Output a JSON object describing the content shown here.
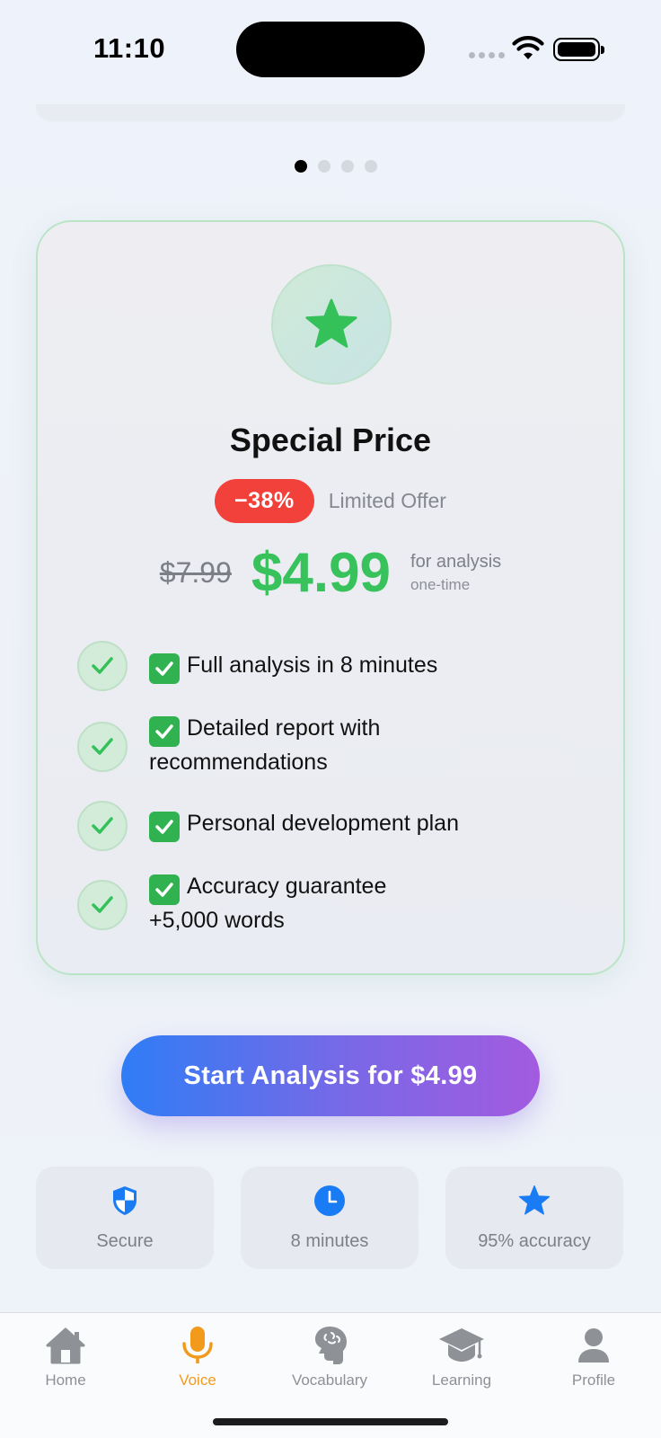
{
  "status_bar": {
    "time": "11:10"
  },
  "pager": {
    "total": 4,
    "active_index": 0
  },
  "offer_card": {
    "icon": "star-icon",
    "title": "Special Price",
    "discount": "−38%",
    "offer_label": "Limited Offer",
    "old_price": "$7.99",
    "new_price": "$4.99",
    "price_note": "for analysis",
    "price_subnote": "one-time",
    "features": [
      {
        "lines": [
          "Full analysis in 8 minutes"
        ]
      },
      {
        "lines": [
          "Detailed report with",
          "recommendations"
        ]
      },
      {
        "lines": [
          "Personal development plan"
        ]
      },
      {
        "lines": [
          "Accuracy guarantee",
          "+5,000 words"
        ]
      }
    ]
  },
  "cta": {
    "label": "Start Analysis for $4.99"
  },
  "trust_badges": [
    {
      "icon": "shield-icon",
      "label": "Secure"
    },
    {
      "icon": "clock-icon",
      "label": "8 minutes"
    },
    {
      "icon": "star-icon",
      "label": "95% accuracy"
    }
  ],
  "tab_bar": {
    "active": "Voice",
    "tabs": [
      {
        "icon": "house-icon",
        "label": "Home"
      },
      {
        "icon": "microphone-icon",
        "label": "Voice"
      },
      {
        "icon": "brain-icon",
        "label": "Vocabulary"
      },
      {
        "icon": "graduation-cap-icon",
        "label": "Learning"
      },
      {
        "icon": "person-icon",
        "label": "Profile"
      }
    ]
  },
  "colors": {
    "accent_green": "#38c25c",
    "discount_red": "#f2413a",
    "cta_gradient_start": "#2f7df6",
    "cta_gradient_end": "#a35be0",
    "active_tab": "#f29a1c",
    "trust_icon_blue": "#1a7cf4"
  }
}
